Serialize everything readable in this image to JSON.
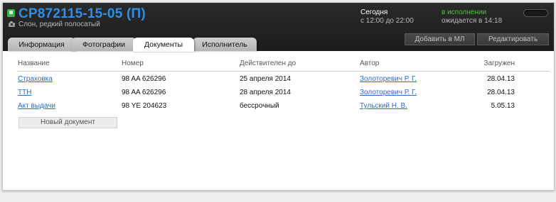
{
  "header": {
    "order_id": "CP872115-15-05 (П)",
    "subtitle": "Слон, редкий полосатый",
    "today_label": "Сегодня",
    "today_time": "с 12:00 до 22:00",
    "status": "в исполнении",
    "expected": "ожидается в 14:18",
    "add_ml_label": "Добавить в МЛ",
    "edit_label": "Редактировать",
    "status_color": "#49c53a",
    "title_color": "#2d8fe8"
  },
  "tabs": [
    {
      "label": "Информация",
      "active": false
    },
    {
      "label": "Фотографии",
      "active": false
    },
    {
      "label": "Документы",
      "active": true
    },
    {
      "label": "Исполнитель",
      "active": false
    }
  ],
  "documents": {
    "columns": [
      "Название",
      "Номер",
      "Действителен до",
      "Автор",
      "Загружен"
    ],
    "rows": [
      [
        "Страховка",
        "98 AA 626296",
        "25 апреля 2014",
        "Золоторевич Р. Г.",
        "28.04.13"
      ],
      [
        "ТТН",
        "98 AA 626296",
        "28 апреля 2014",
        "Золоторевич Р. Г.",
        "28.04.13"
      ],
      [
        "Акт выдачи",
        "98 YE 204623",
        "бессрочный",
        "Тульский Н. В.",
        "5.05.13"
      ]
    ],
    "new_document_label": "Новый документ"
  },
  "icons": {
    "status": "status-square-icon",
    "camera": "camera-icon"
  }
}
